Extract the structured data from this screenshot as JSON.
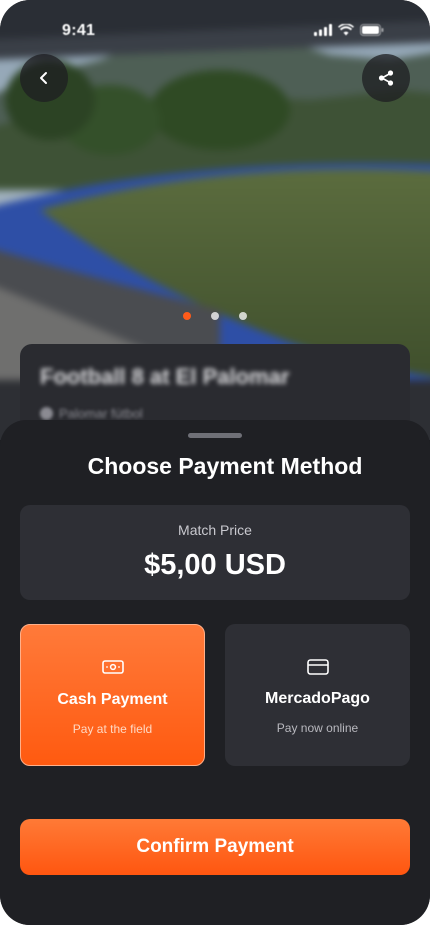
{
  "status_bar": {
    "time": "9:41"
  },
  "hero": {
    "back_icon": "chevron-left-icon",
    "share_icon": "share-icon",
    "carousel": {
      "count": 3,
      "active_index": 0
    }
  },
  "match": {
    "title": "Football 8 at El Palomar",
    "venue": "Palomar fútbol"
  },
  "sheet": {
    "title": "Choose Payment Method",
    "price_label": "Match Price",
    "price_value": "$5,00 USD",
    "options": [
      {
        "title": "Cash Payment",
        "subtitle": "Pay at the field",
        "icon": "cash-icon",
        "selected": true
      },
      {
        "title": "MercadoPago",
        "subtitle": "Pay now online",
        "icon": "card-icon",
        "selected": false
      }
    ],
    "confirm_label": "Confirm Payment"
  },
  "colors": {
    "accent": "#ff5b1a",
    "sheet_background": "#1f2024",
    "card_background": "#2e2f35"
  }
}
